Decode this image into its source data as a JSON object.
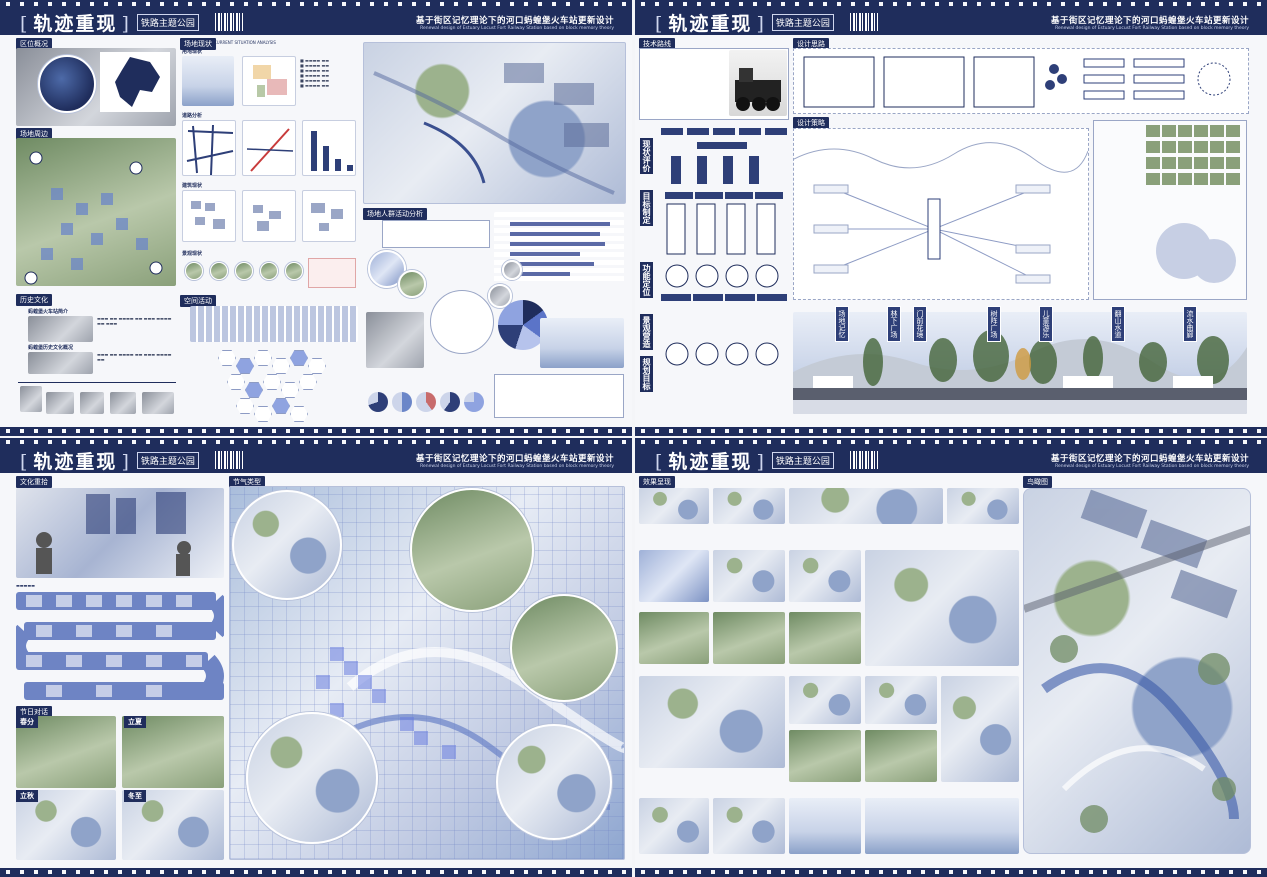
{
  "header": {
    "title": "轨迹重现",
    "subtitle": "铁路主题公园",
    "theme": "基于街区记忆理论下的河口蚂蝗堡火车站更新设计",
    "theme_en": "Renewal design of Estuary Locust Fort Railway Station based on block memory theory"
  },
  "board1": {
    "sections": {
      "area_overview": "区位概况",
      "site_surroundings": "场地周边",
      "history_culture": "历史文化",
      "site_status": "场地现状",
      "site_status_en": "CURRENT SITUATION ANALYSIS",
      "land_use": "用地现状",
      "road_analysis": "道路分析",
      "building_status": "建筑现状",
      "landscape_status": "景观现状",
      "space_activity": "空间活动",
      "crowd_analysis": "场地人群活动分析"
    },
    "history_items": [
      "蚂蝗堡火车站简介",
      "蚂蝗堡历史文化概况"
    ]
  },
  "board2": {
    "sections": {
      "tech_route": "技术路线",
      "design_thinking": "设计思路",
      "design_strategy": "设计策略"
    },
    "route_labels": [
      "现状评价",
      "目标制定",
      "功能定位",
      "景观营造",
      "规划目标"
    ],
    "section_tags": [
      "场地记忆",
      "林下广场",
      "门前花境",
      "树阵广场",
      "儿童游乐",
      "翻山水道",
      "流水曲廊"
    ]
  },
  "board3": {
    "sections": {
      "culture_recall": "文化重拾",
      "festival_types": "节气类型",
      "festival_dialog": "节日对话"
    },
    "seasons": [
      "春分",
      "立夏",
      "立秋",
      "冬至"
    ]
  },
  "board4": {
    "sections": {
      "effect_display": "效果呈现",
      "birdseye": "鸟瞰图"
    }
  },
  "colors": {
    "navy": "#1f2d5c",
    "accent": "#2e3f78",
    "paper": "#f6f7fa"
  }
}
